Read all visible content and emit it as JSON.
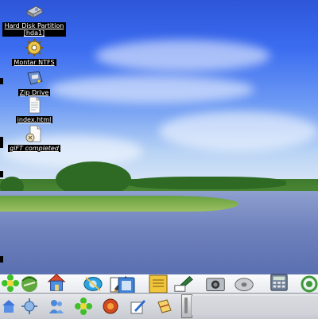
{
  "desktop": {
    "icons": [
      {
        "label": "Hard Disk Partition [hda1]",
        "icon": "hard-disk-icon"
      },
      {
        "label": "Montar NTFS",
        "icon": "gear-icon"
      },
      {
        "label": "Zip Drive",
        "icon": "zip-drive-icon"
      },
      {
        "label": "index.html",
        "icon": "html-file-icon"
      },
      {
        "label": "giFT completed",
        "icon": "folder-download-icon"
      }
    ]
  },
  "dock": {
    "top_row": [
      "icq-icon",
      "browser-icon",
      "home-icon",
      "konqueror-icon",
      "editor-icon",
      "notes-icon",
      "terminal-icon",
      "image-viewer-icon",
      "cd-player-icon",
      "calculator-icon",
      "network-icon"
    ],
    "bottom_row": [
      "kde-home-icon",
      "network-settings-icon",
      "users-icon",
      "icq-flower-icon",
      "web-browser-icon",
      "text-editor-icon",
      "office-icon"
    ]
  },
  "colors": {
    "label_bg": "#000000",
    "label_fg": "#ffffff",
    "panel_bg": "#d6d8dc"
  }
}
